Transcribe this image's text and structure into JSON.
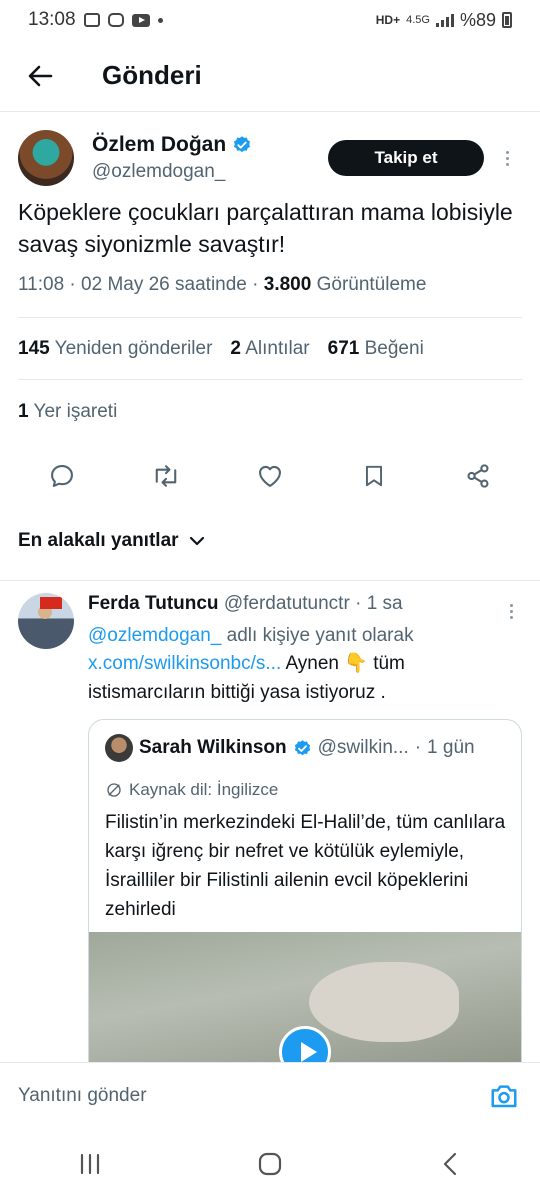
{
  "status_bar": {
    "time": "13:08",
    "network": "4.5G",
    "battery": "%89"
  },
  "header": {
    "title": "Gönderi"
  },
  "post": {
    "author_name": "Özlem Doğan",
    "author_handle": "@ozlemdogan_",
    "follow_label": "Takip et",
    "text": "Köpeklere çocukları parçalattıran mama lobisiyle savaş siyonizmle savaştır!",
    "time": "11:08",
    "date": "02 May 26 saatinde",
    "views_count": "3.800",
    "views_label": "Görüntüleme",
    "reposts_count": "145",
    "reposts_label": "Yeniden gönderiler",
    "quotes_count": "2",
    "quotes_label": "Alıntılar",
    "likes_count": "671",
    "likes_label": "Beğeni",
    "bookmarks_count": "1",
    "bookmarks_label": "Yer işareti"
  },
  "sort": {
    "label": "En alakalı yanıtlar"
  },
  "reply": {
    "name": "Ferda Tutuncu",
    "handle": "@ferdatutunctr",
    "time": "1 sa",
    "reply_to_handle": "@ozlemdogan_",
    "reply_to_suffix": "adlı kişiye yanıt olarak",
    "link": "x.com/swilkinsonbc/s...",
    "text_after_link": "Aynen 👇 tüm istismarcıların bittiği yasa istiyoruz .",
    "quote": {
      "name": "Sarah Wilkinson",
      "handle": "@swilkin...",
      "time": "1 gün",
      "source_label": "Kaynak dil: İngilizce",
      "text": "Filistin’in merkezindeki El-Halil’de, tüm canlılara karşı iğrenç bir nefret ve kötülük eylemiyle, İsrailliler bir Filistinli ailenin evcil köpeklerini zehirledi"
    }
  },
  "reply_bar": {
    "placeholder": "Yanıtını gönder"
  },
  "colors": {
    "accent": "#1d9bf0",
    "text": "#0f1419",
    "muted": "#536471"
  }
}
